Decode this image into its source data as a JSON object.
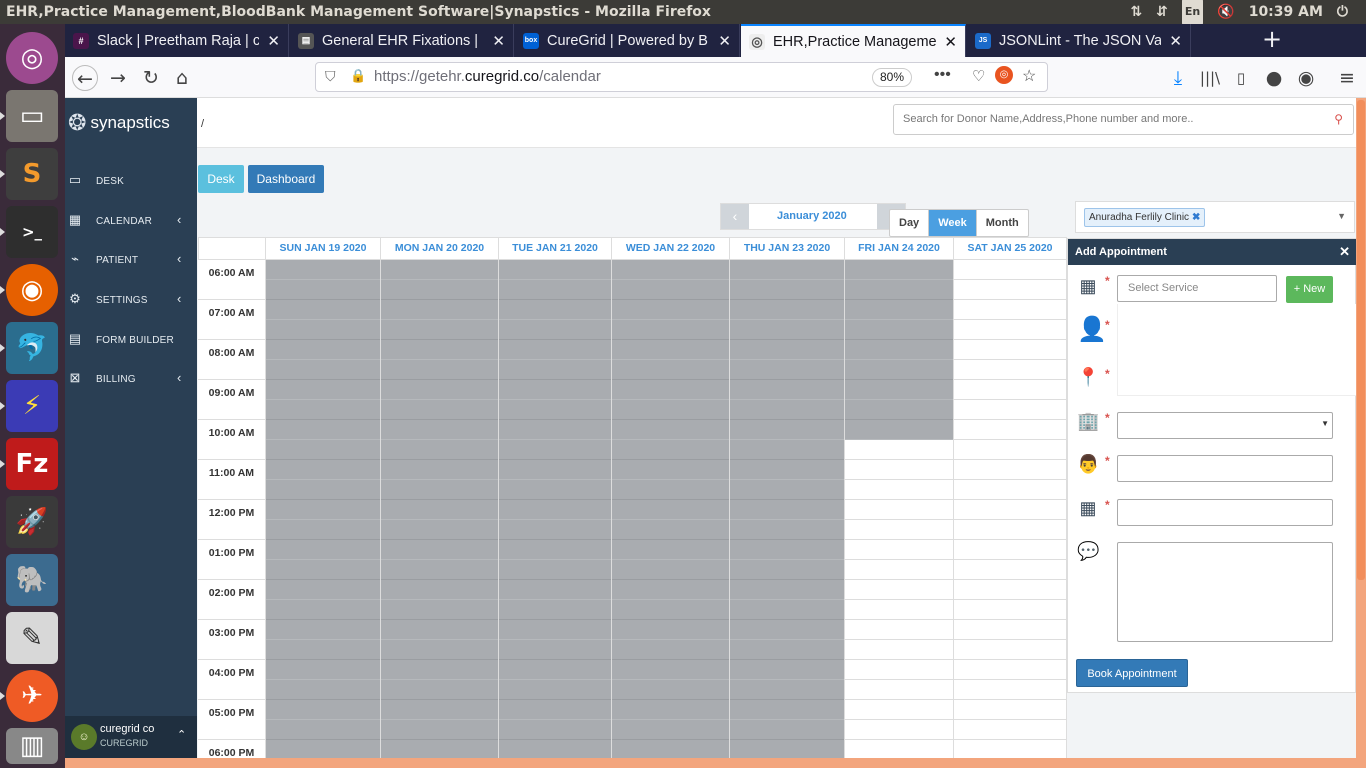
{
  "window": {
    "title": "EHR,Practice Management,BloodBank Management Software|Synapstics - Mozilla Firefox",
    "clock": "10:39 AM",
    "kb": "En"
  },
  "tabs": [
    {
      "label": "Slack | Preetham Raja | c",
      "color": "#4a154b",
      "glyph": "#"
    },
    {
      "label": "General EHR Fixations |",
      "color": "#555",
      "glyph": "▤"
    },
    {
      "label": "CureGrid | Powered by B",
      "color": "#0061d5",
      "glyph": "box"
    },
    {
      "label": "EHR,Practice Manageme",
      "color": "#ddd",
      "glyph": "◎"
    },
    {
      "label": "JSONLint - The JSON Va",
      "color": "#1b6ac9",
      "glyph": "JS"
    }
  ],
  "url": {
    "pre": "https://getehr.",
    "host": "curegrid.co",
    "path": "/calendar",
    "zoom": "80%"
  },
  "brand": "synapstics",
  "menu": [
    {
      "label": "DESK",
      "icon": "▭",
      "chev": ""
    },
    {
      "label": "CALENDAR",
      "icon": "▦",
      "chev": "‹"
    },
    {
      "label": "PATIENT",
      "icon": "⌁",
      "chev": "‹"
    },
    {
      "label": "SETTINGS",
      "icon": "⚙",
      "chev": "‹"
    },
    {
      "label": "FORM BUILDER",
      "icon": "▤",
      "chev": ""
    },
    {
      "label": "BILLING",
      "icon": "⊠",
      "chev": "‹"
    }
  ],
  "profile": {
    "name": "curegrid co",
    "org": "CUREGRID"
  },
  "breadcrumb": "/",
  "search_placeholder": "Search for Donor Name,Address,Phone number and more..",
  "buttons": {
    "desk": "Desk",
    "dashboard": "Dashboard",
    "book": "Book Appointment",
    "new": "+ New"
  },
  "calendar": {
    "month": "January 2020",
    "views": [
      "Day",
      "Week",
      "Month"
    ],
    "active_view": "Week",
    "days": [
      "SUN JAN 19 2020",
      "MON JAN 20 2020",
      "TUE JAN 21 2020",
      "WED JAN 22 2020",
      "THU JAN 23 2020",
      "FRI JAN 24 2020",
      "SAT JAN 25 2020"
    ],
    "times": [
      "06:00 AM",
      "07:00 AM",
      "08:00 AM",
      "09:00 AM",
      "10:00 AM",
      "11:00 AM",
      "12:00 PM",
      "01:00 PM",
      "02:00 PM",
      "03:00 PM",
      "04:00 PM",
      "05:00 PM",
      "06:00 PM"
    ]
  },
  "clinic": "Anuradha Ferlily Clinic",
  "panel": {
    "title": "Add Appointment",
    "service_placeholder": "Select Service"
  },
  "colors": {
    "sidebar": "#2a3f54",
    "accent": "#4b9fe1",
    "blocked": "#a9acb0"
  }
}
